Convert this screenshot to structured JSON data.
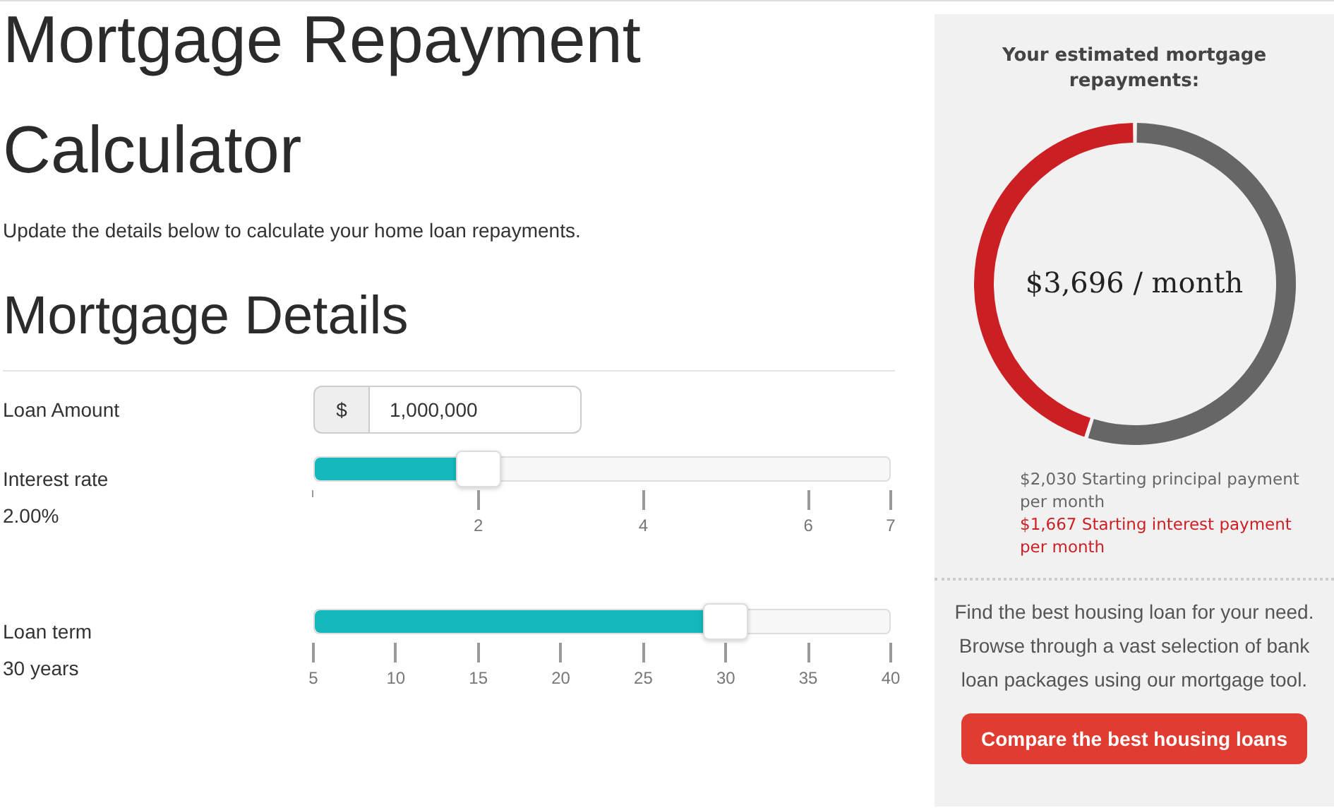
{
  "title": "Mortgage Repayment Calculator",
  "intro": "Update the details below to calculate your home loan repayments.",
  "section_title": "Mortgage Details",
  "loan_amount": {
    "label": "Loan Amount",
    "prefix": "$",
    "value": "1,000,000"
  },
  "sliders": [
    {
      "label": "Interest rate",
      "reading": "2.00%",
      "level": 0.286,
      "start_tick": true,
      "ticks": [
        "2",
        "4",
        "6",
        "7"
      ]
    },
    {
      "label": "Loan term",
      "reading": "30 years",
      "level": 0.714,
      "start_tick": false,
      "ticks": [
        "5",
        "10",
        "15",
        "20",
        "25",
        "30",
        "35",
        "40"
      ]
    }
  ],
  "summary": {
    "heading": "Your estimated mortgage repayments:",
    "total": "$3,696 / month",
    "chart_data": {
      "type": "donut",
      "categories": [
        "Starting principal payment per month",
        "Starting interest payment per month"
      ],
      "values": [
        54.9,
        45.1
      ]
    },
    "legend": [
      {
        "amount": "$2,030",
        "color": "#666666"
      },
      {
        "amount": "$1,667",
        "color": "#cc1f24"
      }
    ],
    "promo": "Find the best housing loan for your need. Browse through a vast selection of bank loan packages using our mortgage tool.",
    "button": "Compare the best housing loans"
  }
}
